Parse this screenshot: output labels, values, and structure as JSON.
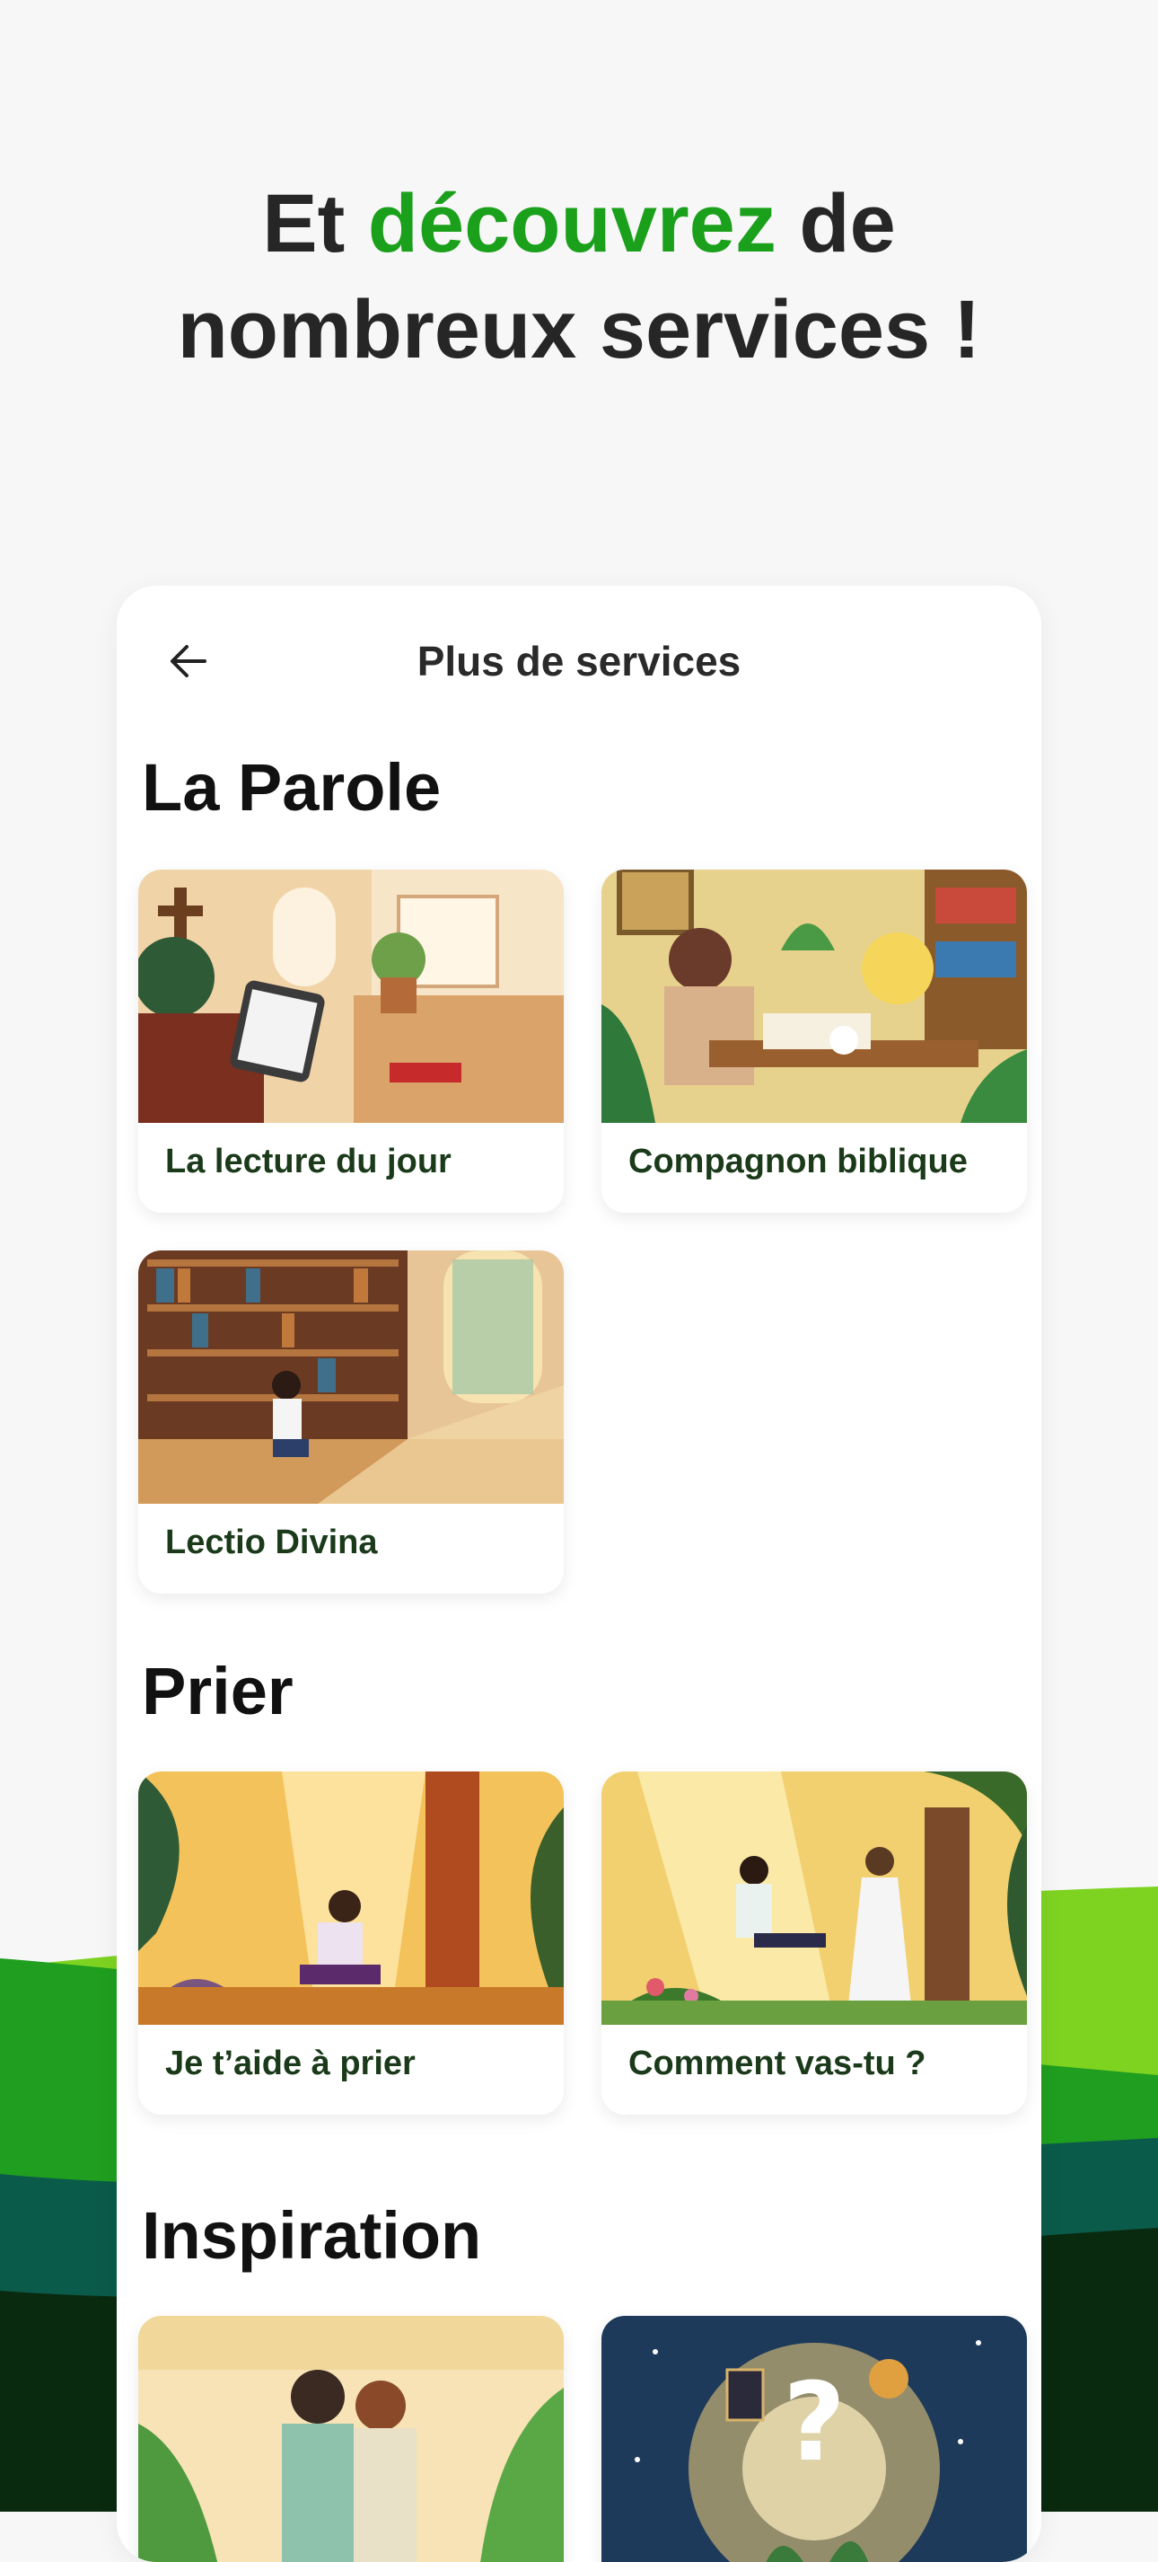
{
  "promo": {
    "line1_prefix": "Et ",
    "line1_accent": "découvrez",
    "line1_suffix": " de",
    "line2": "nombreux services !"
  },
  "topbar": {
    "title": "Plus de services",
    "back_icon": "arrow-left-icon"
  },
  "sections": [
    {
      "title": "La Parole",
      "cards": [
        {
          "label": "La lecture du jour"
        },
        {
          "label": "Compagnon biblique"
        },
        {
          "label": "Lectio Divina"
        }
      ]
    },
    {
      "title": "Prier",
      "cards": [
        {
          "label": "Je t’aide à prier"
        },
        {
          "label": "Comment vas-tu ?"
        }
      ]
    },
    {
      "title": "Inspiration",
      "cards": [
        {
          "label": ""
        },
        {
          "label": ""
        }
      ]
    }
  ],
  "colors": {
    "accent": "#1aa01a",
    "text_dark": "#262626",
    "wave_light": "#7ed321",
    "wave_mid": "#1f9e1f",
    "wave_dark": "#0b5b4a",
    "wave_darkest": "#0a2a10"
  }
}
